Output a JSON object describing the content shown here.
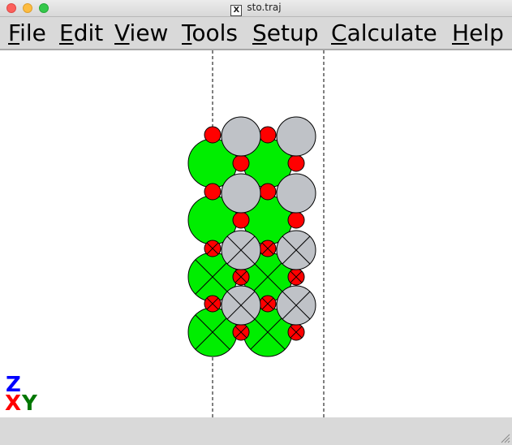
{
  "window": {
    "title": "sto.traj",
    "controls": [
      "close",
      "minimize",
      "maximize"
    ],
    "title_icon": "x11-icon",
    "title_icon_glyph": "X"
  },
  "menubar": {
    "items": [
      {
        "id": "file",
        "label": "File",
        "mnemonic": "F"
      },
      {
        "id": "edit",
        "label": "Edit",
        "mnemonic": "E"
      },
      {
        "id": "view",
        "label": "View",
        "mnemonic": "V"
      },
      {
        "id": "tools",
        "label": "Tools",
        "mnemonic": "T"
      },
      {
        "id": "setup",
        "label": "Setup",
        "mnemonic": "S"
      },
      {
        "id": "calculate",
        "label": "Calculate",
        "mnemonic": "C"
      },
      {
        "id": "help",
        "label": "Help",
        "mnemonic": "H"
      }
    ]
  },
  "colors": {
    "sr": "#00ee00",
    "ti": "#bfc2c7",
    "o": "#ff0000",
    "axis_x": "#ff0000",
    "axis_y": "#007700",
    "axis_z": "#0000ff",
    "panel": "#d9d9d9"
  },
  "axes": {
    "x_label": "X",
    "y_label": "Y",
    "z_label": "Z"
  },
  "statusbar": {
    "text": ""
  },
  "resize_grip_icon": "resize-grip-icon"
}
